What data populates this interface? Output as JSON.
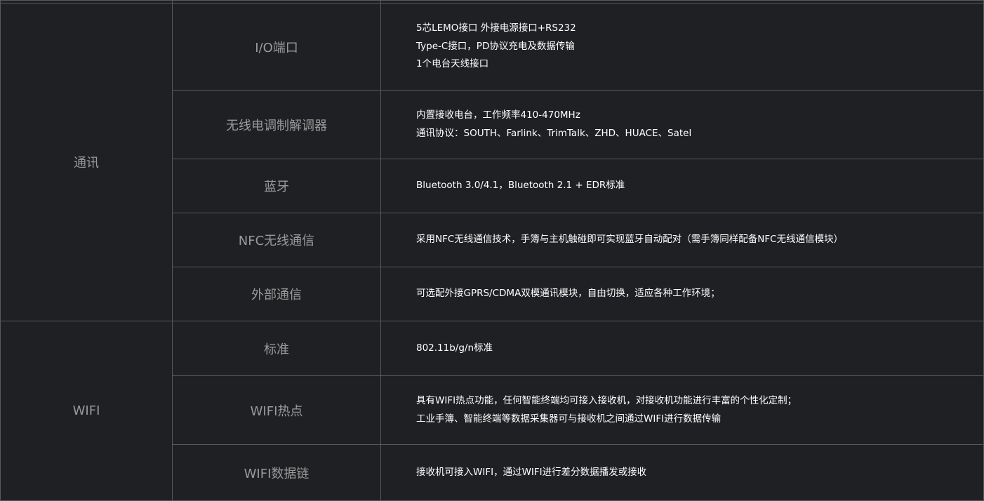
{
  "rows": [
    {
      "category": "通讯",
      "items": [
        {
          "name": "I/O端口",
          "lines": [
            "5芯LEMO接口 外接电源接口+RS232",
            "Type-C接口，PD协议充电及数据传输",
            "1个电台天线接口"
          ]
        },
        {
          "name": "无线电调制解调器",
          "lines": [
            "内置接收电台，工作频率410-470MHz",
            "通讯协议：SOUTH、Farlink、TrimTalk、ZHD、HUACE、Satel"
          ]
        },
        {
          "name": "蓝牙",
          "lines": [
            "Bluetooth 3.0/4.1，Bluetooth 2.1 + EDR标准"
          ]
        },
        {
          "name": "NFC无线通信",
          "lines": [
            "采用NFC无线通信技术，手簿与主机触碰即可实现蓝牙自动配对（需手簿同样配备NFC无线通信模块）"
          ]
        },
        {
          "name": "外部通信",
          "lines": [
            "可选配外接GPRS/CDMA双模通讯模块，自由切换，适应各种工作环境；"
          ]
        }
      ]
    },
    {
      "category": "WIFI",
      "items": [
        {
          "name": "标准",
          "lines": [
            "802.11b/g/n标准"
          ]
        },
        {
          "name": "WIFI热点",
          "lines": [
            "具有WIFI热点功能，任何智能终端均可接入接收机，对接收机功能进行丰富的个性化定制；",
            "工业手簿、智能终端等数据采集器可与接收机之间通过WIFI进行数据传输"
          ]
        },
        {
          "name": "WIFI数据链",
          "lines": [
            "接收机可接入WIFI，通过WIFI进行差分数据播发或接收"
          ]
        }
      ]
    }
  ]
}
